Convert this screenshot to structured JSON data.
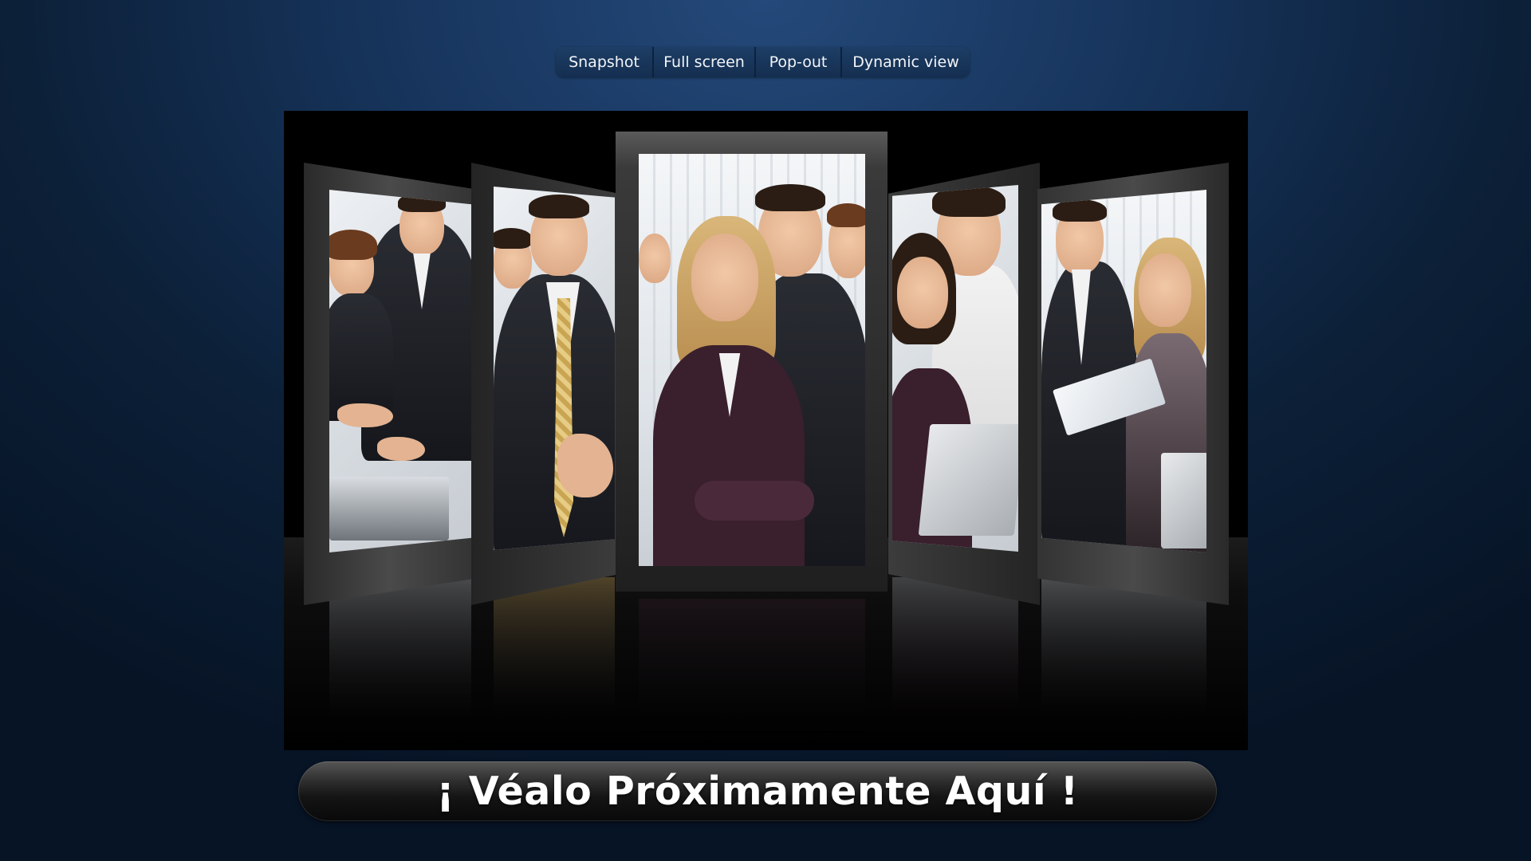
{
  "toolbar": {
    "snapshot_label": "Snapshot",
    "fullscreen_label": "Full screen",
    "popout_label": "Pop-out",
    "dynamic_view_label": "Dynamic view"
  },
  "gallery": {
    "images": [
      "business team reaching hands",
      "smiling businessman in gold tie",
      "confident businesswoman with team",
      "businesswoman looking at laptop",
      "colleagues reviewing folder"
    ]
  },
  "banner": {
    "text": "¡ Véalo Próximamente Aquí !"
  },
  "colors": {
    "background": "#16335a",
    "toolbar": "#17355a",
    "stage": "#000000",
    "banner_text": "#ffffff"
  }
}
